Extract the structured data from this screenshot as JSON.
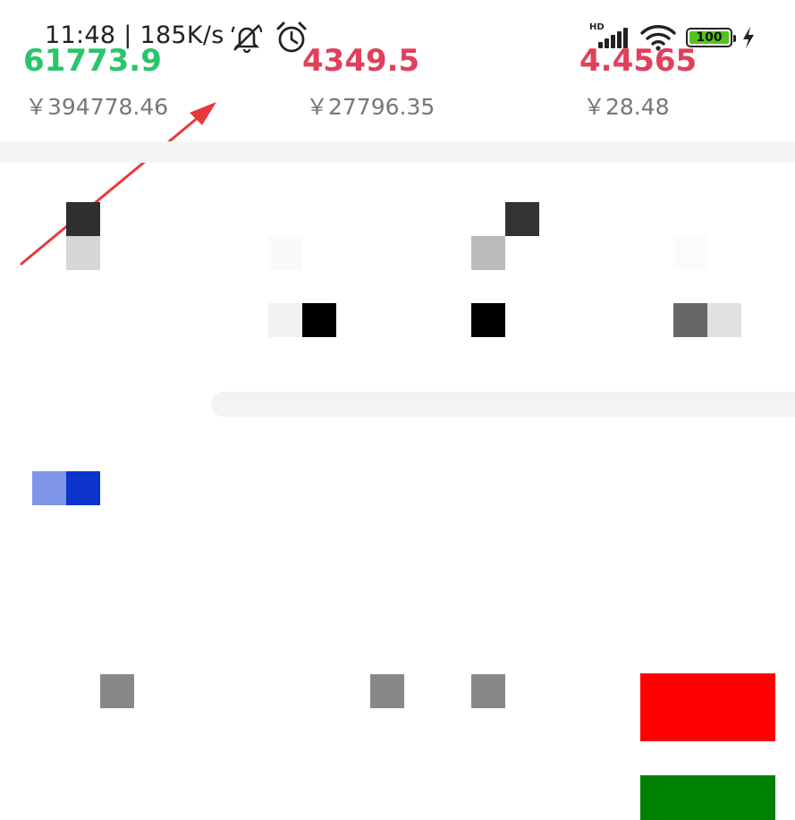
{
  "status_bar": {
    "time_speed": "11:48 | 185K/s",
    "network_label": "HD",
    "battery_level": "100"
  },
  "assets": [
    {
      "value": "61773.9",
      "cny": "￥394778.46",
      "color": "#29c56a"
    },
    {
      "value": "4349.5",
      "cny": "￥27796.35",
      "color": "#e0405a"
    },
    {
      "value": "4.4565",
      "cny": "￥28.48",
      "color": "#e0405a"
    }
  ],
  "icons": {
    "alarm": "alarm-clock-icon",
    "mute": "bell-off-icon",
    "wifi": "wifi-icon",
    "charging": "lightning-icon"
  },
  "colors": {
    "sell_button": "#ff0000",
    "buy_button": "#008000",
    "annotation_arrow": "#e8393a"
  }
}
